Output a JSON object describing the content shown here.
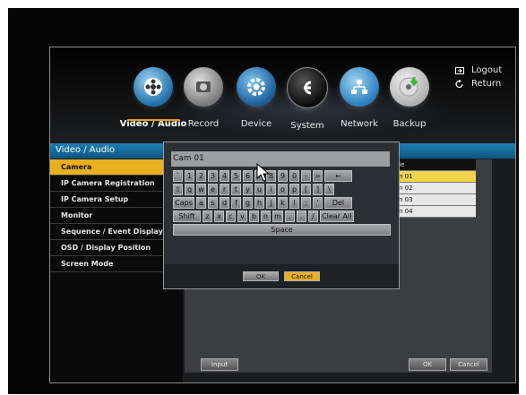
{
  "nav": {
    "items": [
      {
        "label": "Video / Audio",
        "icon": "film-reel-icon",
        "active": true
      },
      {
        "label": "Record",
        "icon": "record-icon"
      },
      {
        "label": "Device",
        "icon": "gear-icon"
      },
      {
        "label": "System",
        "icon": "system-icon"
      },
      {
        "label": "Network",
        "icon": "network-icon"
      },
      {
        "label": "Backup",
        "icon": "disc-backup-icon"
      }
    ],
    "logout": "Logout",
    "return": "Return"
  },
  "menu_title": "Video / Audio",
  "sidebar": {
    "items": [
      {
        "label": "Camera",
        "selected": true
      },
      {
        "label": "IP Camera Registration"
      },
      {
        "label": "IP Camera Setup"
      },
      {
        "label": "Monitor"
      },
      {
        "label": "Sequence / Event Display"
      },
      {
        "label": "OSD / Display Position"
      },
      {
        "label": "Screen Mode"
      }
    ]
  },
  "table": {
    "header": "le",
    "rows": [
      "n 01",
      "n 02",
      "n 03",
      "n 04"
    ]
  },
  "bottom": {
    "input_label": "Input",
    "ok_label": "OK",
    "cancel_label": "Cancel"
  },
  "keyboard": {
    "input_value": "Cam 01",
    "rows": [
      [
        "`",
        "1",
        "2",
        "3",
        "4",
        "5",
        "6",
        "7",
        "8",
        "9",
        "0",
        "-",
        "=",
        "←"
      ],
      [
        "⇧",
        "q",
        "w",
        "e",
        "r",
        "t",
        "y",
        "u",
        "i",
        "o",
        "p",
        "[",
        "]",
        "\\"
      ],
      [
        "Caps",
        "a",
        "s",
        "d",
        "f",
        "g",
        "h",
        "j",
        "k",
        "l",
        ";",
        "'",
        "Del"
      ],
      [
        "Shift",
        "z",
        "x",
        "c",
        "v",
        "b",
        "n",
        "m",
        ",",
        ".",
        "/",
        "Clear All"
      ]
    ],
    "space_label": "Space",
    "ok_label": "OK",
    "cancel_label": "Cancel"
  },
  "colors": {
    "accent": "#e8b020",
    "menu_header": "#1d7fb3",
    "selected_row": "#f1d44a"
  }
}
